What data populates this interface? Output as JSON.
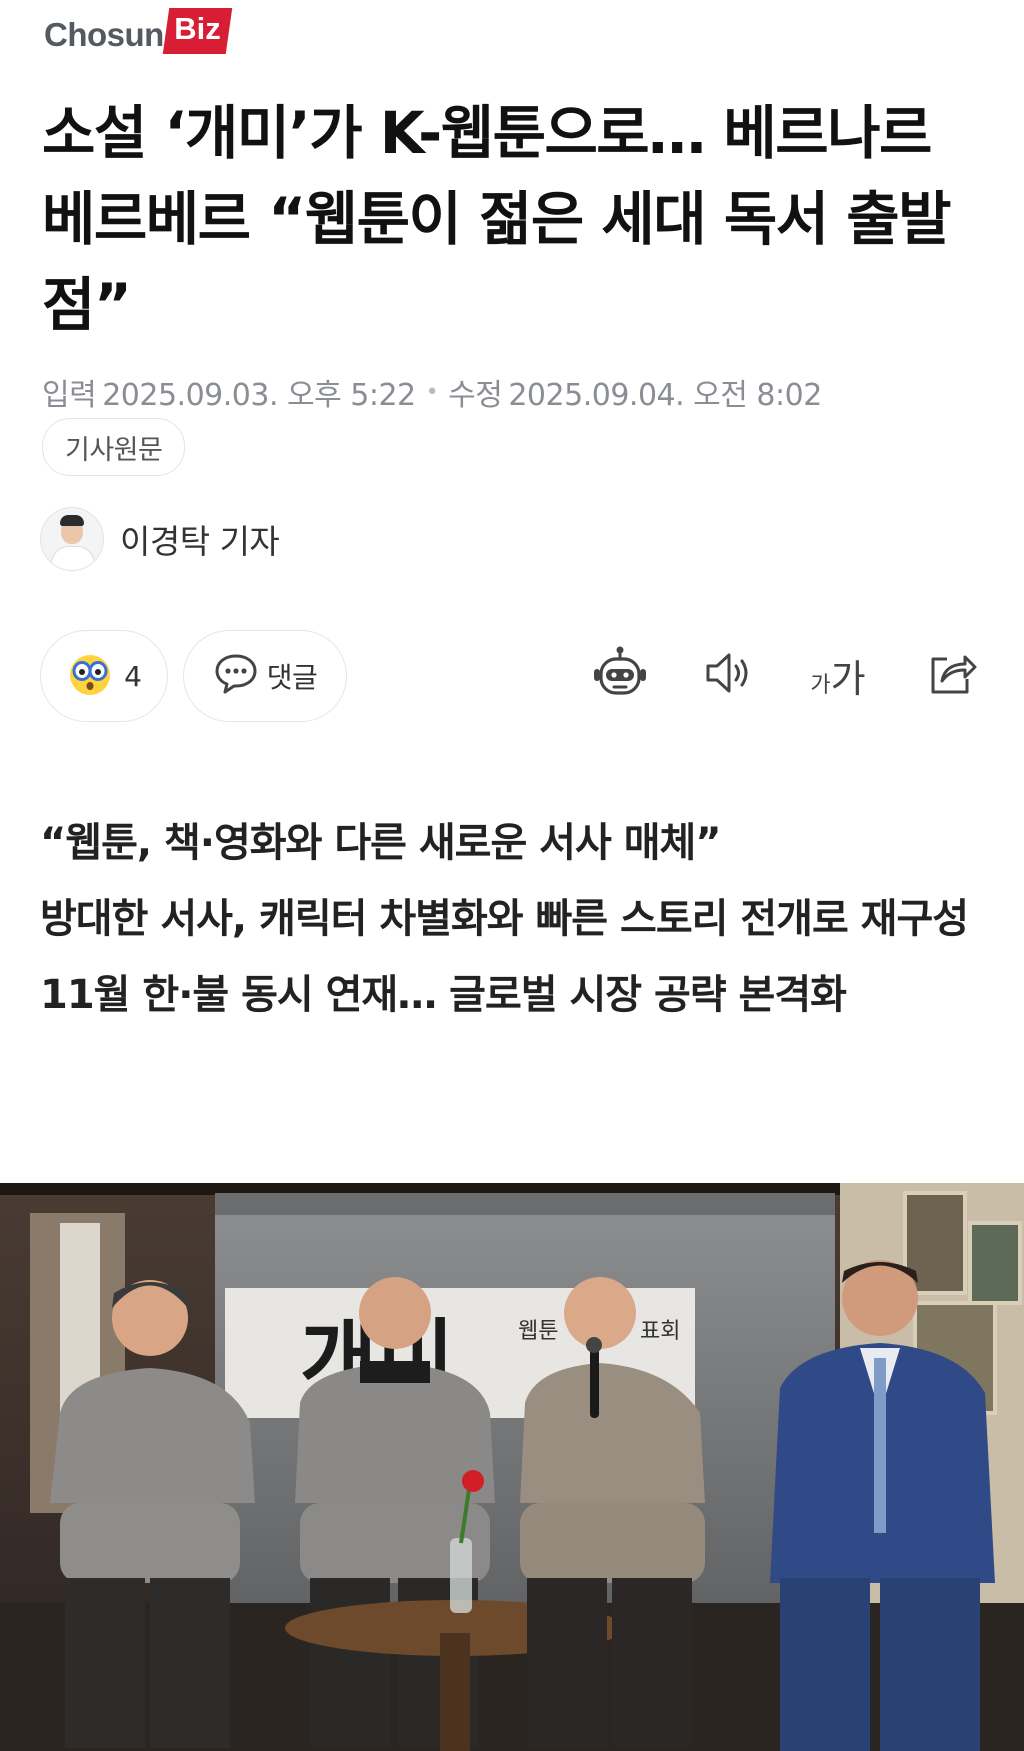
{
  "logo": {
    "text_main": "Chosun",
    "text_accent": "Biz",
    "accent_color": "#d71e34"
  },
  "article": {
    "title": "소설 ‘개미’가 K-웹툰으로… 베르나르 베르베르 “웹툰이 젊은 세대 독서 출발점”",
    "input_label": "입력",
    "input_time": "2025.09.03. 오후 5:22",
    "edit_label": "수정",
    "edit_time": "2025.09.04. 오전 8:02",
    "source_chip": "기사원문",
    "author": "이경탁 기자",
    "subtitle_lines": [
      "“웹툰, 책·영화와 다른 새로운 서사 매체”",
      "방대한 서사, 캐릭터 차별화와 빠른 스토리 전개로 재구성",
      "11월 한·불 동시 연재… 글로벌 시장 공략 본격화"
    ]
  },
  "actions": {
    "reaction_icon": "surprised-face-icon",
    "reaction_count": "4",
    "comment_icon": "speech-bubble-icon",
    "comment_label": "댓글",
    "tools": [
      "robot-icon",
      "speaker-icon",
      "font-size-icon",
      "share-icon"
    ],
    "font_small": "가",
    "font_big": "가"
  },
  "photo": {
    "screen_title": "개미",
    "screen_subtitle": "웹툰 ",
    "screen_subtitle_end": "표회"
  }
}
